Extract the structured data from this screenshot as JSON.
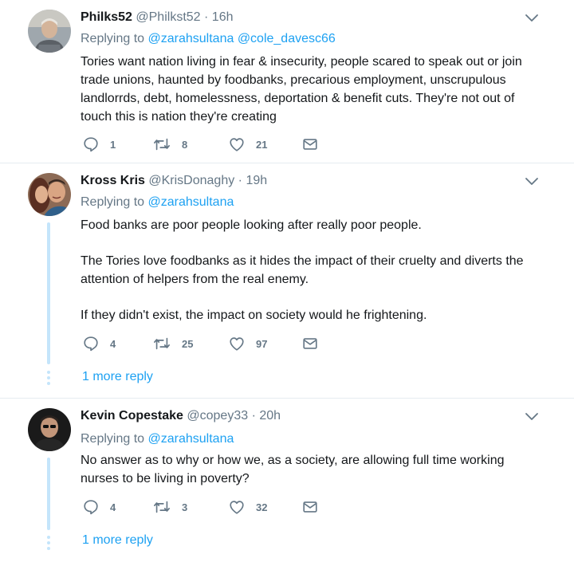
{
  "tweets": [
    {
      "name": "Philks52",
      "handle": "@Philkst52",
      "time": "16h",
      "replying_label": "Replying to",
      "replying_to": [
        "@zarahsultana",
        "@cole_davesc66"
      ],
      "paragraphs": [
        "Tories want nation living in fear & insecurity, people scared to speak out or join trade unions, haunted by foodbanks, precarious employment, unscrupulous landlorrds, debt, homelessness, deportation & benefit cuts. They're not out of touch this is nation they're creating"
      ],
      "replies": "1",
      "retweets": "8",
      "likes": "21"
    },
    {
      "name": "Kross Kris",
      "handle": "@KrisDonaghy",
      "time": "19h",
      "replying_label": "Replying to",
      "replying_to": [
        "@zarahsultana"
      ],
      "paragraphs": [
        "Food banks are poor people looking after really poor people.",
        "The Tories love foodbanks as it hides the impact of their cruelty and diverts the attention of helpers from the real enemy.",
        "If they didn't exist, the impact on society would he frightening."
      ],
      "replies": "4",
      "retweets": "25",
      "likes": "97",
      "more_replies": "1 more reply"
    },
    {
      "name": "Kevin Copestake",
      "handle": "@copey33",
      "time": "20h",
      "replying_label": "Replying to",
      "replying_to": [
        "@zarahsultana"
      ],
      "paragraphs": [
        "No answer as to why or how we, as a society, are allowing full time working nurses to be living in poverty?"
      ],
      "replies": "4",
      "retweets": "3",
      "likes": "32",
      "more_replies": "1 more reply"
    }
  ],
  "separator": "·",
  "colors": {
    "link": "#1da1f2",
    "muted": "#657786",
    "thread": "#c4e5fb",
    "divider": "#e6ecf0"
  },
  "icons": [
    "reply-icon",
    "retweet-icon",
    "like-icon",
    "direct-message-icon",
    "chevron-down-icon"
  ]
}
